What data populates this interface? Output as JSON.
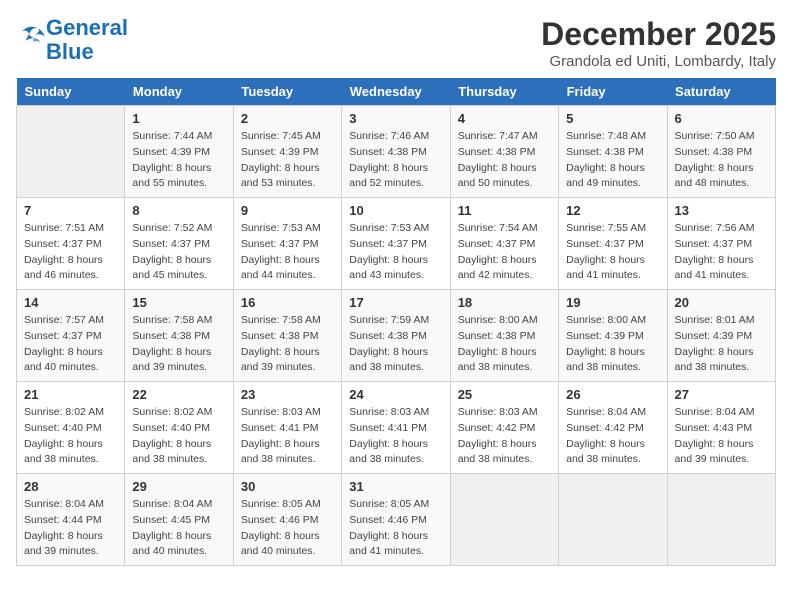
{
  "header": {
    "logo_line1": "General",
    "logo_line2": "Blue",
    "month": "December 2025",
    "location": "Grandola ed Uniti, Lombardy, Italy"
  },
  "days_of_week": [
    "Sunday",
    "Monday",
    "Tuesday",
    "Wednesday",
    "Thursday",
    "Friday",
    "Saturday"
  ],
  "weeks": [
    [
      {
        "day": "",
        "info": ""
      },
      {
        "day": "1",
        "info": "Sunrise: 7:44 AM\nSunset: 4:39 PM\nDaylight: 8 hours\nand 55 minutes."
      },
      {
        "day": "2",
        "info": "Sunrise: 7:45 AM\nSunset: 4:39 PM\nDaylight: 8 hours\nand 53 minutes."
      },
      {
        "day": "3",
        "info": "Sunrise: 7:46 AM\nSunset: 4:38 PM\nDaylight: 8 hours\nand 52 minutes."
      },
      {
        "day": "4",
        "info": "Sunrise: 7:47 AM\nSunset: 4:38 PM\nDaylight: 8 hours\nand 50 minutes."
      },
      {
        "day": "5",
        "info": "Sunrise: 7:48 AM\nSunset: 4:38 PM\nDaylight: 8 hours\nand 49 minutes."
      },
      {
        "day": "6",
        "info": "Sunrise: 7:50 AM\nSunset: 4:38 PM\nDaylight: 8 hours\nand 48 minutes."
      }
    ],
    [
      {
        "day": "7",
        "info": "Sunrise: 7:51 AM\nSunset: 4:37 PM\nDaylight: 8 hours\nand 46 minutes."
      },
      {
        "day": "8",
        "info": "Sunrise: 7:52 AM\nSunset: 4:37 PM\nDaylight: 8 hours\nand 45 minutes."
      },
      {
        "day": "9",
        "info": "Sunrise: 7:53 AM\nSunset: 4:37 PM\nDaylight: 8 hours\nand 44 minutes."
      },
      {
        "day": "10",
        "info": "Sunrise: 7:53 AM\nSunset: 4:37 PM\nDaylight: 8 hours\nand 43 minutes."
      },
      {
        "day": "11",
        "info": "Sunrise: 7:54 AM\nSunset: 4:37 PM\nDaylight: 8 hours\nand 42 minutes."
      },
      {
        "day": "12",
        "info": "Sunrise: 7:55 AM\nSunset: 4:37 PM\nDaylight: 8 hours\nand 41 minutes."
      },
      {
        "day": "13",
        "info": "Sunrise: 7:56 AM\nSunset: 4:37 PM\nDaylight: 8 hours\nand 41 minutes."
      }
    ],
    [
      {
        "day": "14",
        "info": "Sunrise: 7:57 AM\nSunset: 4:37 PM\nDaylight: 8 hours\nand 40 minutes."
      },
      {
        "day": "15",
        "info": "Sunrise: 7:58 AM\nSunset: 4:38 PM\nDaylight: 8 hours\nand 39 minutes."
      },
      {
        "day": "16",
        "info": "Sunrise: 7:58 AM\nSunset: 4:38 PM\nDaylight: 8 hours\nand 39 minutes."
      },
      {
        "day": "17",
        "info": "Sunrise: 7:59 AM\nSunset: 4:38 PM\nDaylight: 8 hours\nand 38 minutes."
      },
      {
        "day": "18",
        "info": "Sunrise: 8:00 AM\nSunset: 4:38 PM\nDaylight: 8 hours\nand 38 minutes."
      },
      {
        "day": "19",
        "info": "Sunrise: 8:00 AM\nSunset: 4:39 PM\nDaylight: 8 hours\nand 38 minutes."
      },
      {
        "day": "20",
        "info": "Sunrise: 8:01 AM\nSunset: 4:39 PM\nDaylight: 8 hours\nand 38 minutes."
      }
    ],
    [
      {
        "day": "21",
        "info": "Sunrise: 8:02 AM\nSunset: 4:40 PM\nDaylight: 8 hours\nand 38 minutes."
      },
      {
        "day": "22",
        "info": "Sunrise: 8:02 AM\nSunset: 4:40 PM\nDaylight: 8 hours\nand 38 minutes."
      },
      {
        "day": "23",
        "info": "Sunrise: 8:03 AM\nSunset: 4:41 PM\nDaylight: 8 hours\nand 38 minutes."
      },
      {
        "day": "24",
        "info": "Sunrise: 8:03 AM\nSunset: 4:41 PM\nDaylight: 8 hours\nand 38 minutes."
      },
      {
        "day": "25",
        "info": "Sunrise: 8:03 AM\nSunset: 4:42 PM\nDaylight: 8 hours\nand 38 minutes."
      },
      {
        "day": "26",
        "info": "Sunrise: 8:04 AM\nSunset: 4:42 PM\nDaylight: 8 hours\nand 38 minutes."
      },
      {
        "day": "27",
        "info": "Sunrise: 8:04 AM\nSunset: 4:43 PM\nDaylight: 8 hours\nand 39 minutes."
      }
    ],
    [
      {
        "day": "28",
        "info": "Sunrise: 8:04 AM\nSunset: 4:44 PM\nDaylight: 8 hours\nand 39 minutes."
      },
      {
        "day": "29",
        "info": "Sunrise: 8:04 AM\nSunset: 4:45 PM\nDaylight: 8 hours\nand 40 minutes."
      },
      {
        "day": "30",
        "info": "Sunrise: 8:05 AM\nSunset: 4:46 PM\nDaylight: 8 hours\nand 40 minutes."
      },
      {
        "day": "31",
        "info": "Sunrise: 8:05 AM\nSunset: 4:46 PM\nDaylight: 8 hours\nand 41 minutes."
      },
      {
        "day": "",
        "info": ""
      },
      {
        "day": "",
        "info": ""
      },
      {
        "day": "",
        "info": ""
      }
    ]
  ]
}
